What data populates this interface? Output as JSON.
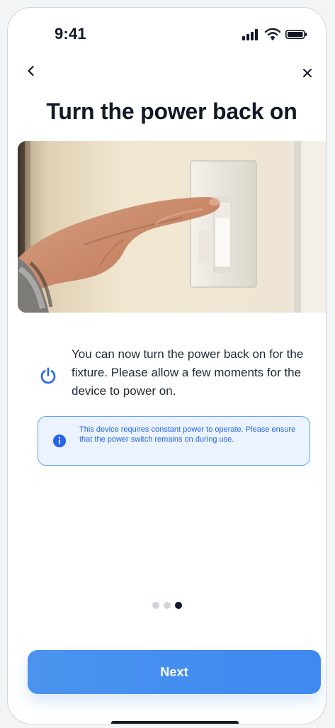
{
  "status_bar": {
    "time": "9:41"
  },
  "header": {
    "title": "Turn the power back on"
  },
  "content": {
    "instruction_text": "You can now turn the power back on for the fixture. Please allow a few moments for the device to power on.",
    "notice_text": "This device requires constant power to operate. Please ensure that the power switch remains on during use."
  },
  "pagination": {
    "current_page": 3,
    "total_pages": 3
  },
  "actions": {
    "next_label": "Next"
  },
  "colors": {
    "primary": "#3f89f2",
    "notice_bg": "#eaf3ff",
    "notice_border": "#60a5fa",
    "notice_text": "#2563eb",
    "title_text": "#111827"
  },
  "icons": {
    "back": "chevron-left-icon",
    "close": "close-icon",
    "signal": "signal-icon",
    "wifi": "wifi-icon",
    "battery": "battery-icon",
    "power": "power-icon",
    "info": "info-icon"
  }
}
